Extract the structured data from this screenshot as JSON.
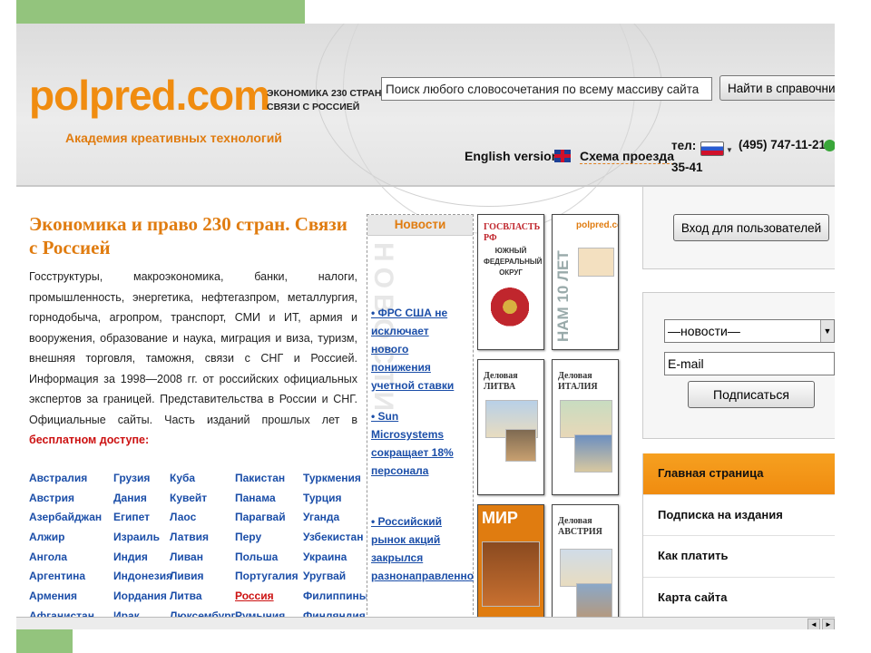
{
  "header": {
    "logo": "polpred.com",
    "tagline": "Академия креативных технологий",
    "header_text_line1": "ЭКОНОМИКА 230 СТРАН",
    "header_text_line2": "СВЯЗИ С РОССИЕЙ",
    "search_value": "Поиск любого словосочетания по всему массиву сайта",
    "search_button": "Найти в справочни",
    "english_version": "English version",
    "route_scheme": "Схема проезда",
    "tel_label": "тел:",
    "tel_number": "(495) 747-11-21",
    "tel_tail": "35-41"
  },
  "main": {
    "title": "Экономика и право 230 стран. Связи с Россией",
    "description": "Госструктуры, макроэкономика, банки, налоги, промышленность, энергетика, нефтегазпром, металлургия, горнодобыча, агропром, транспорт, СМИ и ИТ, армия и вооружения, образование и наука, миграция и виза, туризм, внешняя торговля, таможня, связи с СНГ и Россией. Информация за 1998—2008 гг. от российских официальных экспертов за границей. Представительства в России и СНГ. Официальные сайты. Часть изданий прошлых лет в ",
    "free_access": "бесплатном доступе:",
    "countries": [
      [
        "Австралия",
        "Австрия",
        "Азербайджан",
        "Алжир",
        "Ангола",
        "Аргентина",
        "Армения",
        "Афганистан"
      ],
      [
        "Грузия",
        "Дания",
        "Египет",
        "Израиль",
        "Индия",
        "Индонезия",
        "Иордания",
        "Ирак"
      ],
      [
        "Куба",
        "Кувейт",
        "Лаос",
        "Латвия",
        "Ливан",
        "Ливия",
        "Литва",
        "Люксембург"
      ],
      [
        "Пакистан",
        "Панама",
        "Парагвай",
        "Перу",
        "Польша",
        "Португалия",
        "Россия",
        "Румыния"
      ],
      [
        "Туркмения",
        "Турция",
        "Уганда",
        "Узбекистан",
        "Украина",
        "Уругвай",
        "Филиппины",
        "Финляндия"
      ]
    ]
  },
  "news": {
    "header": "Новости",
    "watermark": "НОВОСТИ",
    "items": [
      "• ФРС США не исключает нового понижения учетной ставки",
      "• Sun Microsystems сокращает 18% персонала",
      "• Российский рынок акций закрылся разнонаправленно"
    ]
  },
  "covers": [
    {
      "title": "ГОСВЛАСТЬ РФ",
      "subtitle": "ЮЖНЫЙ ФЕДЕРАЛЬНЫЙ ОКРУГ"
    },
    {
      "title": "polpred.com",
      "subtitle": "НАМ 10 ЛЕТ"
    },
    {
      "title": "Деловая ЛИТВА",
      "subtitle": ""
    },
    {
      "title": "Деловая ИТАЛИЯ",
      "subtitle": ""
    },
    {
      "title": "МИР",
      "subtitle": ""
    },
    {
      "title": "Деловая АВСТРИЯ",
      "subtitle": ""
    }
  ],
  "right": {
    "login_button": "Вход для пользователей",
    "select_value": "—новости—",
    "email_value": "E-mail",
    "subscribe_button": "Подписаться",
    "menu": [
      "Главная страница",
      "Подписка на издания",
      "Как платить",
      "Карта сайта"
    ]
  },
  "colors": {
    "brand_orange": "#f08c10",
    "link_blue": "#1b4ea8",
    "slide_green": "#93c47d"
  }
}
